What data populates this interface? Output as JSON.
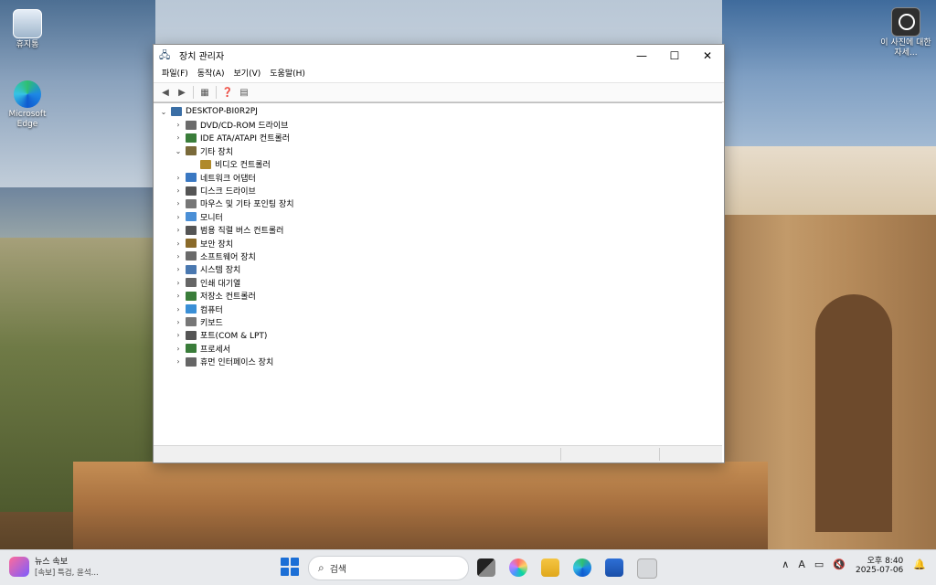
{
  "desktop": {
    "icons": [
      {
        "label": "휴지통",
        "icon": "recycle-bin-icon"
      },
      {
        "label": "Microsoft Edge",
        "icon": "edge-icon"
      },
      {
        "label": "이 사진에 대한 자세...",
        "icon": "account-icon"
      }
    ]
  },
  "window": {
    "title": "장치 관리자",
    "controls": {
      "minimize": "—",
      "maximize": "☐",
      "close": "✕"
    },
    "menu": [
      "파일(F)",
      "동작(A)",
      "보기(V)",
      "도움말(H)"
    ],
    "tree": {
      "root": "DESKTOP-BI0R2PJ",
      "items": [
        {
          "label": "DVD/CD-ROM 드라이브",
          "expanded": false,
          "color": "#6b6b6b"
        },
        {
          "label": "IDE ATA/ATAPI 컨트롤러",
          "expanded": false,
          "color": "#3a7d3a"
        },
        {
          "label": "기타 장치",
          "expanded": true,
          "color": "#7a6a3a"
        },
        {
          "label": "비디오 컨트롤러",
          "child": true,
          "color": "#b08a2a"
        },
        {
          "label": "네트워크 어댑터",
          "expanded": false,
          "color": "#3a78c2"
        },
        {
          "label": "디스크 드라이브",
          "expanded": false,
          "color": "#555555"
        },
        {
          "label": "마우스 및 기타 포인팅 장치",
          "expanded": false,
          "color": "#777777"
        },
        {
          "label": "모니터",
          "expanded": false,
          "color": "#4a8fd6"
        },
        {
          "label": "범용 직렬 버스 컨트롤러",
          "expanded": false,
          "color": "#555555"
        },
        {
          "label": "보안 장치",
          "expanded": false,
          "color": "#8a6a2a"
        },
        {
          "label": "소프트웨어 장치",
          "expanded": false,
          "color": "#6a6a6a"
        },
        {
          "label": "시스템 장치",
          "expanded": false,
          "color": "#4a78b0"
        },
        {
          "label": "인쇄 대기열",
          "expanded": false,
          "color": "#666666"
        },
        {
          "label": "저장소 컨트롤러",
          "expanded": false,
          "color": "#3a7d3a"
        },
        {
          "label": "컴퓨터",
          "expanded": false,
          "color": "#3a8fd6"
        },
        {
          "label": "키보드",
          "expanded": false,
          "color": "#777777"
        },
        {
          "label": "포트(COM & LPT)",
          "expanded": false,
          "color": "#555555"
        },
        {
          "label": "프로세서",
          "expanded": false,
          "color": "#3a7d3a"
        },
        {
          "label": "휴먼 인터페이스 장치",
          "expanded": false,
          "color": "#666666"
        }
      ]
    }
  },
  "taskbar": {
    "news_title": "뉴스 속보",
    "news_sub": "[속보] 특검, 윤석...",
    "search_placeholder": "검색",
    "tray": {
      "ime": "A"
    },
    "time": "오후 8:40",
    "date": "2025-07-06"
  }
}
